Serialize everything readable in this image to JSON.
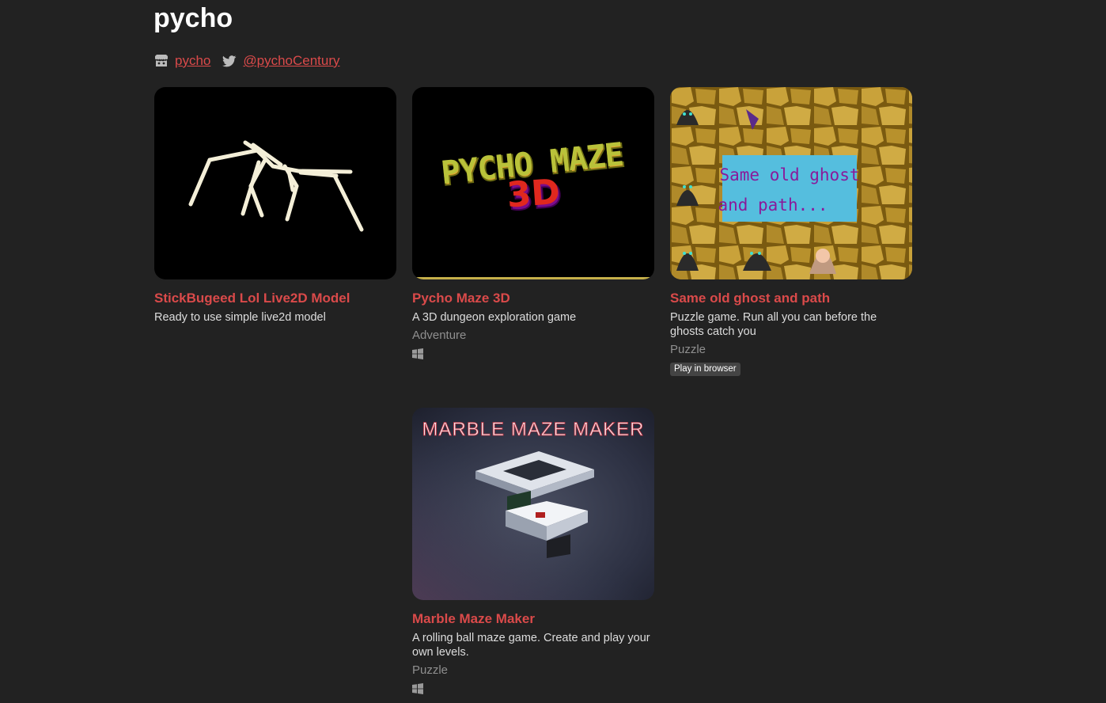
{
  "profile": {
    "title": "pycho",
    "links": [
      {
        "icon": "itchio-icon",
        "label": "pycho"
      },
      {
        "icon": "twitter-icon",
        "label": "@pychoCentury"
      }
    ]
  },
  "games": [
    {
      "title": "StickBugeed Lol Live2D Model",
      "description": "Ready to use simple live2d model",
      "genre": "",
      "platforms": [],
      "badge": ""
    },
    {
      "title": "Pycho Maze 3D",
      "description": "A 3D dungeon exploration game",
      "genre": "Adventure",
      "platforms": [
        "windows-icon"
      ],
      "badge": "",
      "thumb_text": [
        "PYCHO MAZE",
        "3D"
      ]
    },
    {
      "title": "Same old ghost and path",
      "description": "Puzzle game. Run all you can before the ghosts catch you",
      "genre": "Puzzle",
      "platforms": [],
      "badge": "Play in browser",
      "thumb_text": [
        "Same old ghost",
        "and path..."
      ]
    },
    {
      "title": "Marble Maze Maker",
      "description": "A rolling ball maze game. Create and play your own levels.",
      "genre": "Puzzle",
      "platforms": [
        "windows-icon"
      ],
      "badge": "",
      "thumb_text": [
        "MARBLE MAZE MAKER"
      ]
    }
  ],
  "colors": {
    "background": "#222222",
    "link": "#da4a4a",
    "title": "#ffffff",
    "genre": "#8f8f8f"
  }
}
